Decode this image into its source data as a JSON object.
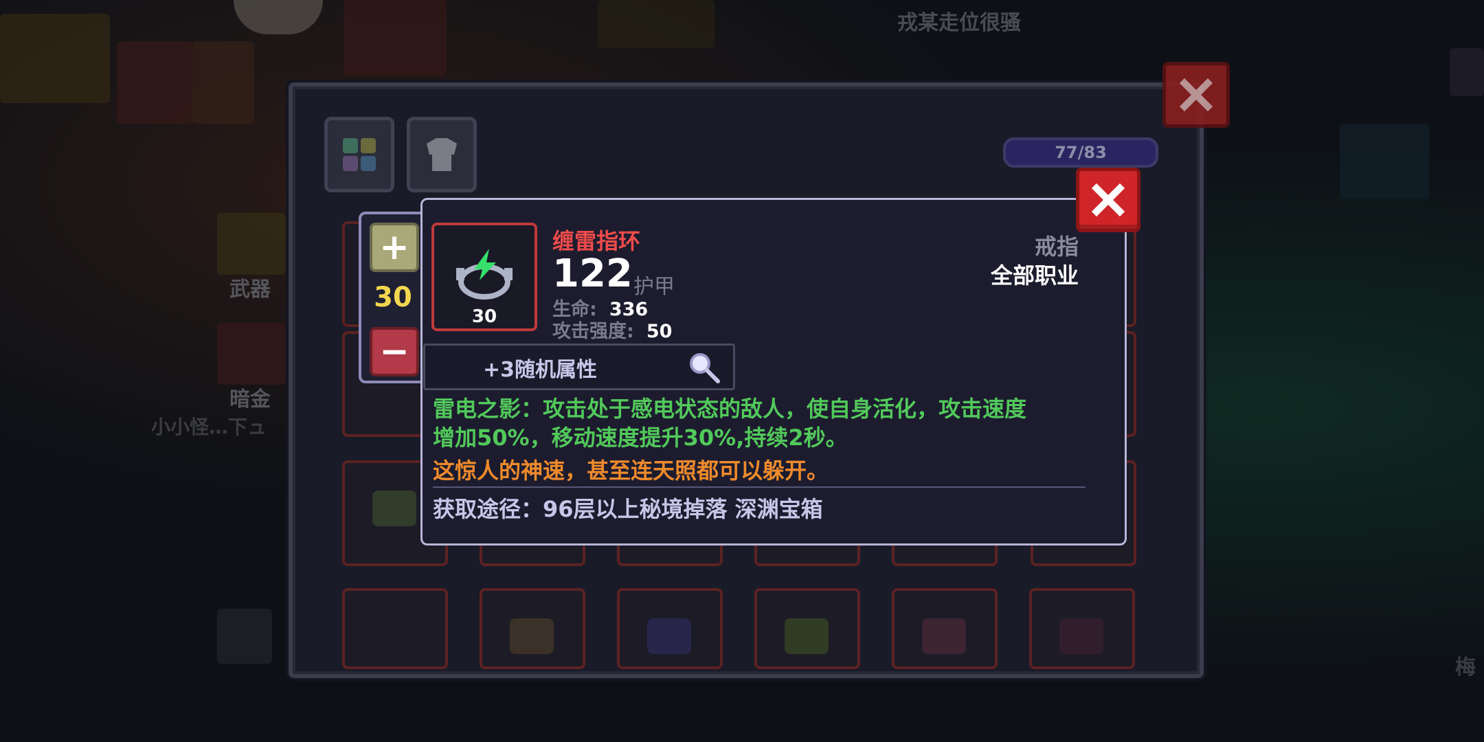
{
  "background": {
    "player_name_top": "戎某走位很骚",
    "sidebar_weapon_label": "武器",
    "sidebar_dark_gold_label": "暗金",
    "player_name_left": "小小怪…下ュ",
    "name_right_edge": "梅"
  },
  "inventory": {
    "capacity": "77/83"
  },
  "stepper": {
    "count": "30",
    "plus_symbol": "+",
    "minus_symbol": "−"
  },
  "item": {
    "name": "缠雷指环",
    "level": "30",
    "armor_value": "122",
    "armor_label": "护甲",
    "stats": [
      {
        "label": "生命:",
        "value": "336"
      },
      {
        "label": "攻击强度:",
        "value": "50"
      }
    ],
    "type": "戒指",
    "class": "全部职业",
    "random_attributes": "+3随机属性",
    "effect_line1": "雷电之影：攻击处于感电状态的敌人，使自身活化，攻击速度",
    "effect_line2": "增加50%，移动速度提升30%,持续2秒。",
    "flavor": "这惊人的神速，甚至连天照都可以躲开。",
    "source": "获取途径：96层以上秘境掉落 深渊宝箱"
  },
  "colors": {
    "item_name": "#ef4b4b",
    "effect": "#52c95b",
    "flavor": "#ef8a2c",
    "stepper_count": "#f3d64f",
    "close_button": "#cf2528"
  },
  "icons": {
    "ring": "ring-lightning-icon",
    "search": "magnifier-icon",
    "close": "close-icon"
  }
}
